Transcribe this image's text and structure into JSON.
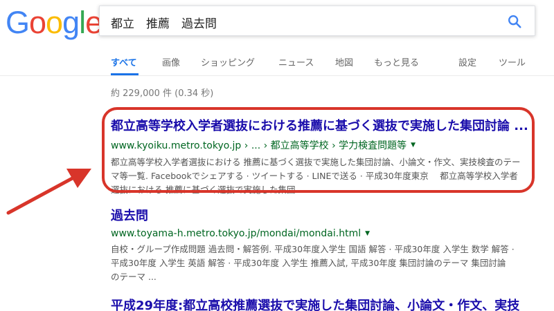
{
  "logo": {
    "text": "Google",
    "letters": [
      "G",
      "o",
      "o",
      "g",
      "l",
      "e"
    ],
    "colors": [
      "#4285f4",
      "#ea4335",
      "#fbbc05",
      "#4285f4",
      "#34a853",
      "#ea4335"
    ]
  },
  "search": {
    "value": "都立　推薦　過去問",
    "icon": "search-icon"
  },
  "tabs": [
    {
      "label": "すべて",
      "active": true
    },
    {
      "label": "画像"
    },
    {
      "label": "ショッピング"
    },
    {
      "label": "ニュース"
    },
    {
      "label": "地図"
    },
    {
      "label": "もっと見る"
    },
    {
      "label": "設定"
    },
    {
      "label": "ツール"
    }
  ],
  "result_stats": "約 229,000 件 (0.34 秒)",
  "results": [
    {
      "title": "都立高等学校入学者選抜における推薦に基づく選抜で実施した集団討論 ...",
      "url": "www.kyoiku.metro.tokyo.jp › ... › 都立高等学校 › 学力検査問題等",
      "snippet_lines": [
        "都立高等学校入学者選抜における 推薦に基づく選抜で実施した集団討論、小論文・作文、実技検査のテー",
        "マ等一覧. Facebookでシェアする · ツイートする · LINEで送る · 平成30年度東京　 都立高等学校入学者",
        "選抜における 推薦に基づく選抜で実施した集団 ..."
      ]
    },
    {
      "title": "過去問",
      "url": "www.toyama-h.metro.tokyo.jp/mondai/mondai.html",
      "snippet_lines": [
        "自校・グループ作成問題 過去問・解答例. 平成30年度入学生 国語 解答 · 平成30年度 入学生 数学 解答 ·",
        "平成30年度 入学生 英語 解答 · 平成30年度 入学生 推薦入試, 平成30年度 集団討論のテーマ 集団討論",
        "のテーマ ..."
      ]
    },
    {
      "title": "平成29年度:都立高校推薦選抜で実施した集団討論、小論文・作文、実技"
    }
  ],
  "colors": {
    "accent": "#1a73e8",
    "link": "#1a0dab",
    "url": "#006621",
    "annotation": "#d8352a"
  }
}
